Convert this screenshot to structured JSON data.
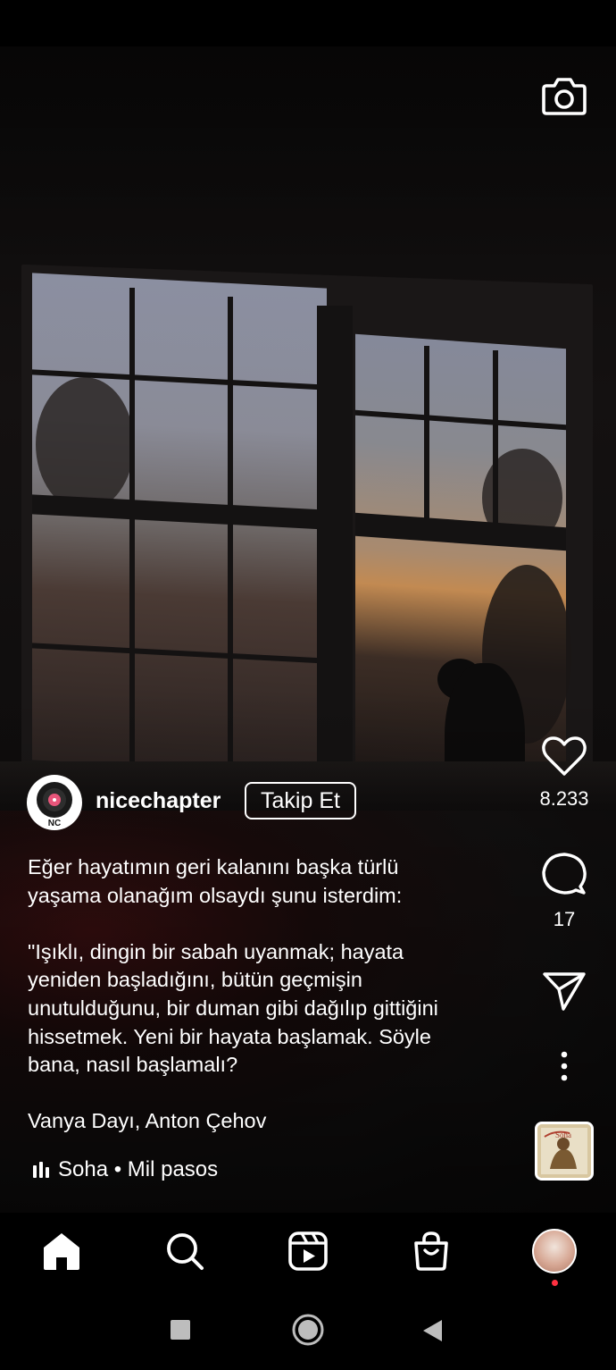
{
  "post": {
    "username": "nicechapter",
    "avatar_initials": "NC",
    "follow_label": "Takip Et",
    "caption": {
      "paragraph1": [
        "Eğer hayatımın geri kalanını başka türlü",
        "yaşama olanağım olsaydı şunu isterdim:"
      ],
      "paragraph2": [
        "\"Işıklı, dingin bir sabah uyanmak; hayata",
        "yeniden başladığını, bütün geçmişin",
        "unutulduğunu, bir duman gibi dağılıp gittiğini",
        "hissetmek. Yeni bir hayata başlamak. Söyle",
        "bana, nasıl başlamalı?"
      ],
      "paragraph3": [
        "Vanya Dayı, Anton Çehov"
      ]
    },
    "music": "Soha • Mil pasos",
    "album_art_title": "Soha"
  },
  "actions": {
    "likes": "8.233",
    "comments": "17"
  },
  "icons": {
    "camera": "camera-icon",
    "like": "heart-icon",
    "comment": "comment-icon",
    "share": "send-icon",
    "more": "more-vertical-icon",
    "home": "home-icon",
    "search": "search-icon",
    "reels": "reels-icon",
    "shop": "shop-icon",
    "profile": "profile-avatar",
    "sys_recent": "square-icon",
    "sys_home": "circle-icon",
    "sys_back": "triangle-back-icon"
  },
  "colors": {
    "background": "#000000",
    "text": "#ffffff",
    "notification_dot": "#ff3040"
  }
}
